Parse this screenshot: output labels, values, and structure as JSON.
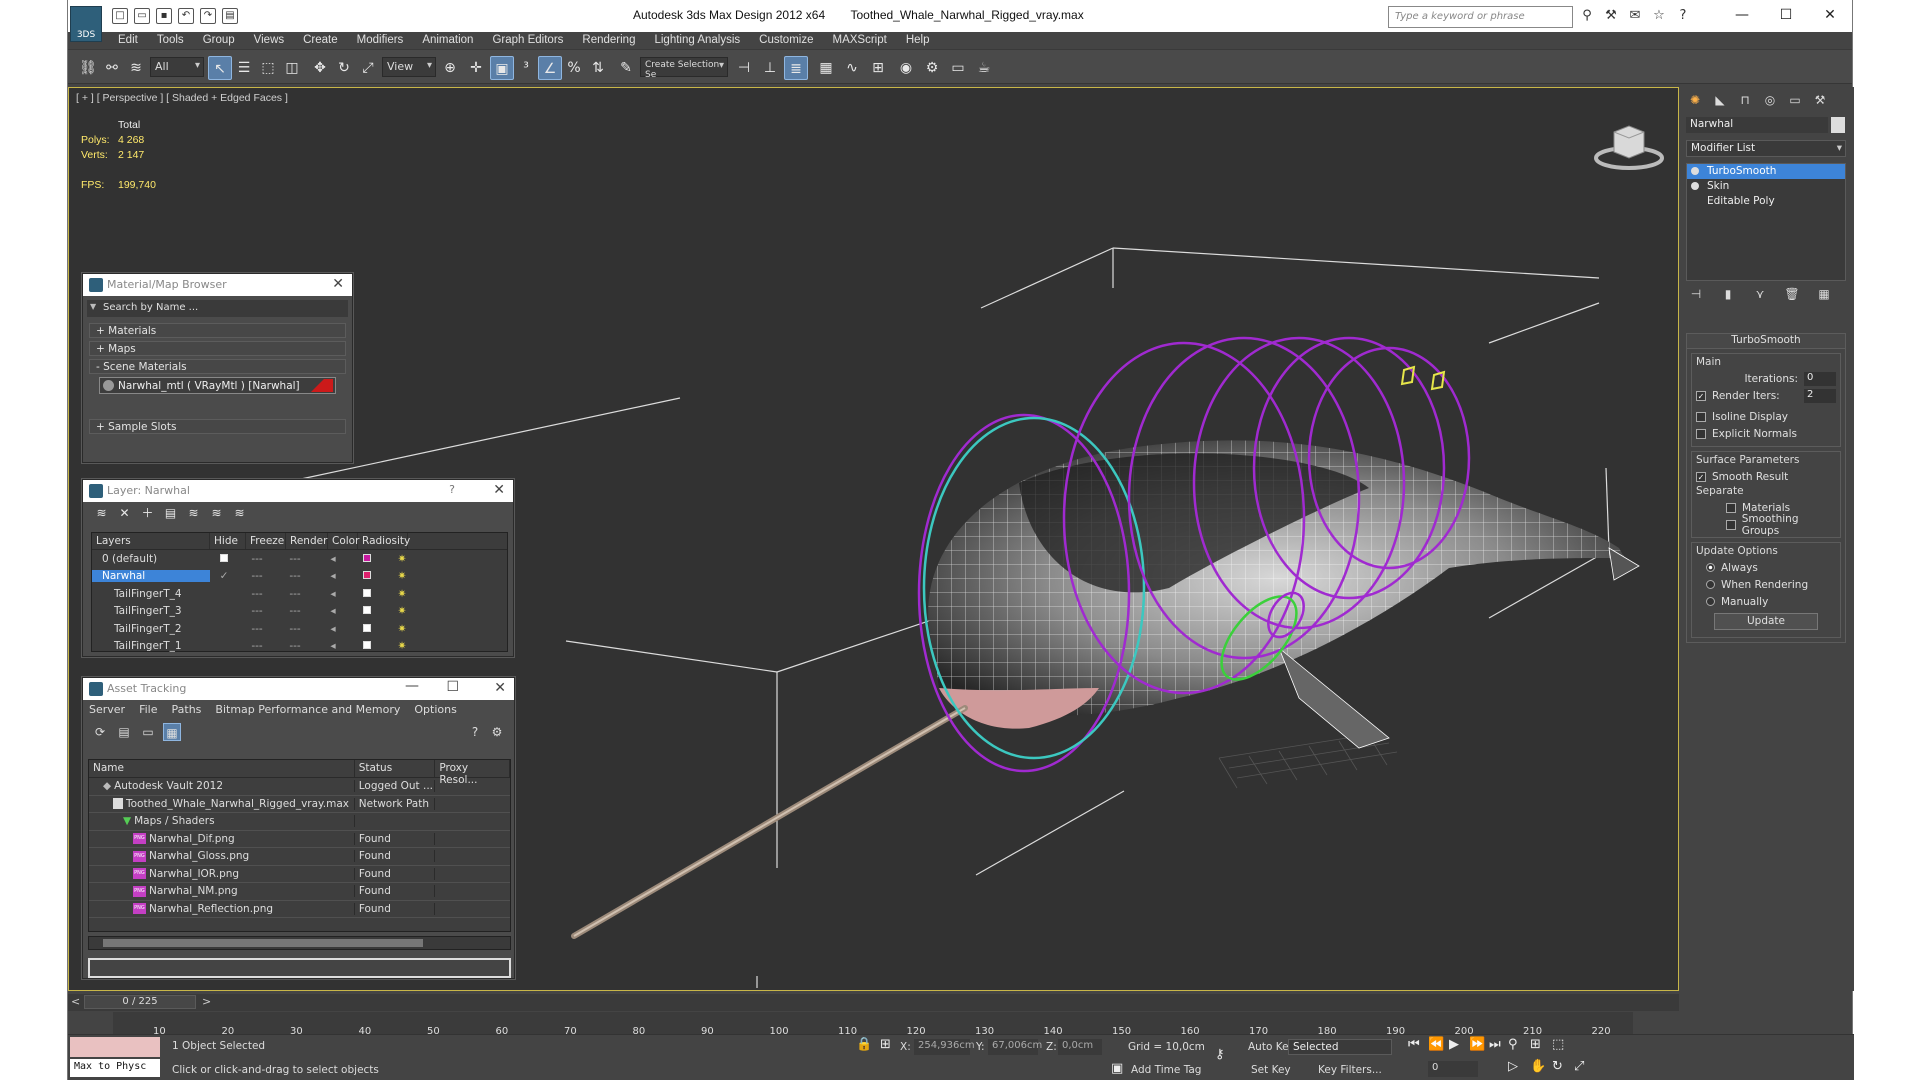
{
  "app": {
    "title": "Autodesk 3ds Max Design 2012 x64",
    "file": "Toothed_Whale_Narwhal_Rigged_vray.max",
    "logo_text": "3DS",
    "search_placeholder": "Type a keyword or phrase"
  },
  "menu": [
    "Edit",
    "Tools",
    "Group",
    "Views",
    "Create",
    "Modifiers",
    "Animation",
    "Graph Editors",
    "Rendering",
    "Lighting Analysis",
    "Customize",
    "MAXScript",
    "Help"
  ],
  "toolbar": {
    "filter": "All",
    "ref_coord": "View",
    "selection_set": "Create Selection Se"
  },
  "viewport": {
    "label": "[ + ] [ Perspective ] [ Shaded + Edged Faces ]",
    "stats": {
      "header": "Total",
      "polys_label": "Polys:",
      "polys": "4 268",
      "verts_label": "Verts:",
      "verts": "2 147",
      "fps_label": "FPS:",
      "fps": "199,740"
    }
  },
  "material_browser": {
    "title": "Material/Map Browser",
    "search": "Search by Name ...",
    "sections": [
      "+ Materials",
      "+ Maps",
      "- Scene Materials",
      "+ Sample Slots"
    ],
    "material": "Narwhal_mtl  ( VRayMtl )  [Narwhal]"
  },
  "layer_dialog": {
    "title": "Layer: Narwhal",
    "help": "?",
    "columns": [
      "Layers",
      "Hide",
      "Freeze",
      "Render",
      "Color",
      "Radiosity"
    ],
    "rows": [
      {
        "name": "0 (default)",
        "color": "#c81aa0",
        "selected": false
      },
      {
        "name": "Narwhal",
        "color": "#e0226e",
        "selected": true
      },
      {
        "name": "TailFingerT_4",
        "color": "#ffffff",
        "selected": false
      },
      {
        "name": "TailFingerT_3",
        "color": "#ffffff",
        "selected": false
      },
      {
        "name": "TailFingerT_2",
        "color": "#ffffff",
        "selected": false
      },
      {
        "name": "TailFingerT_1",
        "color": "#ffffff",
        "selected": false
      }
    ]
  },
  "asset_tracking": {
    "title": "Asset Tracking",
    "menu": [
      "Server",
      "File",
      "Paths",
      "Bitmap Performance and Memory",
      "Options"
    ],
    "columns": [
      "Name",
      "Status",
      "Proxy Resol..."
    ],
    "rows": [
      {
        "name": "Autodesk Vault 2012",
        "status": "Logged Out ...",
        "indent": 1,
        "kind": "vault"
      },
      {
        "name": "Toothed_Whale_Narwhal_Rigged_vray.max",
        "status": "Network Path",
        "indent": 2,
        "kind": "file"
      },
      {
        "name": "Maps / Shaders",
        "status": "",
        "indent": 3,
        "kind": "folder"
      },
      {
        "name": "Narwhal_Dif.png",
        "status": "Found",
        "indent": 4,
        "kind": "png"
      },
      {
        "name": "Narwhal_Gloss.png",
        "status": "Found",
        "indent": 4,
        "kind": "png"
      },
      {
        "name": "Narwhal_IOR.png",
        "status": "Found",
        "indent": 4,
        "kind": "png"
      },
      {
        "name": "Narwhal_NM.png",
        "status": "Found",
        "indent": 4,
        "kind": "png"
      },
      {
        "name": "Narwhal_Reflection.png",
        "status": "Found",
        "indent": 4,
        "kind": "png"
      }
    ]
  },
  "command_panel": {
    "object_name": "Narwhal",
    "modifier_list": "Modifier List",
    "stack": [
      "TurboSmooth",
      "Skin",
      "Editable Poly"
    ],
    "turbosmooth": {
      "title": "TurboSmooth",
      "main_label": "Main",
      "iterations_label": "Iterations:",
      "iterations": "0",
      "render_iters_label": "Render Iters:",
      "render_iters": "2",
      "isoline": "Isoline Display",
      "explicit_normals": "Explicit Normals",
      "surface_label": "Surface Parameters",
      "smooth_result": "Smooth Result",
      "separate_label": "Separate",
      "materials": "Materials",
      "smoothing_groups": "Smoothing Groups",
      "update_label": "Update Options",
      "always": "Always",
      "when_rendering": "When Rendering",
      "manually": "Manually",
      "update_button": "Update"
    }
  },
  "timeline": {
    "frame": "0 / 225",
    "ticks": [
      "10",
      "20",
      "30",
      "40",
      "50",
      "60",
      "70",
      "80",
      "90",
      "100",
      "110",
      "120",
      "130",
      "140",
      "150",
      "160",
      "170",
      "180",
      "190",
      "200",
      "210",
      "220"
    ]
  },
  "status": {
    "selected": "1 Object Selected",
    "prompt": "Click or click-and-drag to select objects",
    "script": "Max to Physc",
    "x_label": "X:",
    "x": "254,936cm",
    "y_label": "Y:",
    "y": "67,006cm",
    "z_label": "Z:",
    "z": "0,0cm",
    "grid": "Grid = 10,0cm",
    "add_time_tag": "Add Time Tag",
    "auto_key": "Auto Key",
    "set_key": "Set Key",
    "key_mode": "Selected",
    "key_filters": "Key Filters...",
    "current_frame": "0"
  },
  "colors": {
    "selection_blue": "#3d84d8",
    "viewport_border": "#c8b648",
    "stats_yellow": "#ffe96b",
    "bone_purple": "#a02ad0",
    "bone_cyan": "#3cc8c0"
  }
}
